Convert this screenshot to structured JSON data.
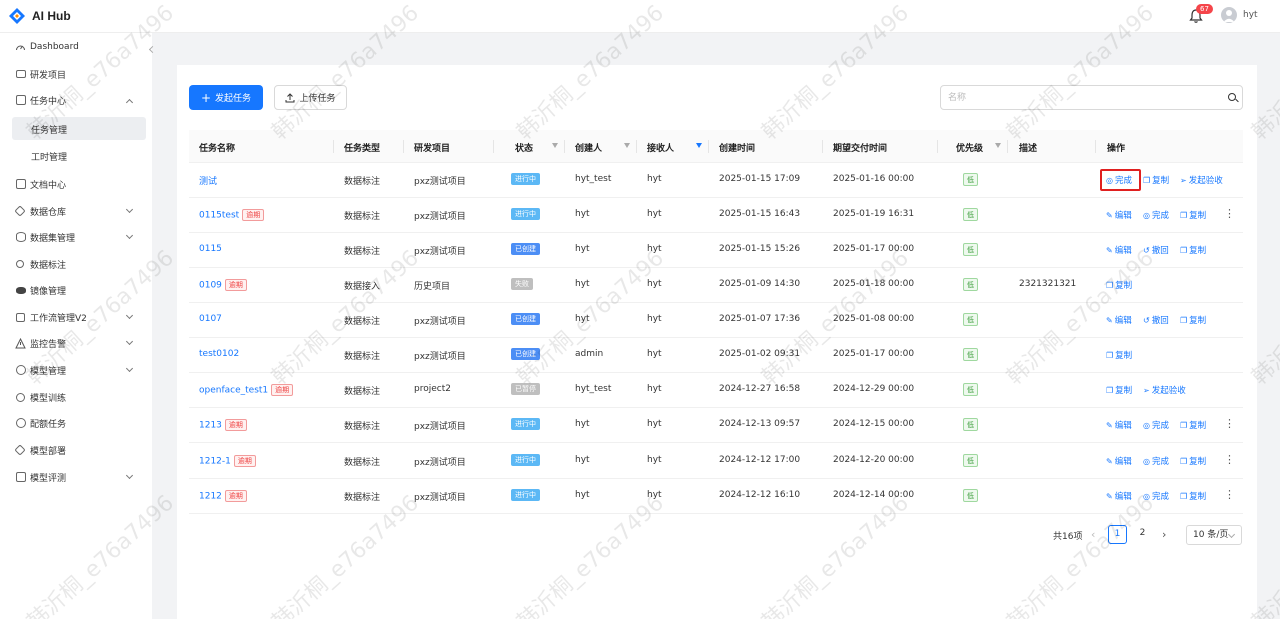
{
  "app": {
    "name": "AI Hub",
    "notification_count": "67",
    "username": "hyt"
  },
  "sidebar": {
    "items": [
      {
        "label": "Dashboard",
        "icon": "dashboard-icon"
      },
      {
        "label": "研发项目",
        "icon": "folder-icon"
      },
      {
        "label": "任务中心",
        "icon": "task-icon",
        "expanded": true
      },
      {
        "label": "任务管理",
        "sub": true,
        "active": true
      },
      {
        "label": "工时管理",
        "sub": true
      },
      {
        "label": "文档中心",
        "icon": "doc-icon"
      },
      {
        "label": "数据仓库",
        "icon": "warehouse-icon"
      },
      {
        "label": "数据集管理",
        "icon": "database-icon"
      },
      {
        "label": "数据标注",
        "icon": "annotation-icon"
      },
      {
        "label": "镜像管理",
        "icon": "image-icon"
      },
      {
        "label": "工作流管理V2",
        "icon": "workflow-icon"
      },
      {
        "label": "监控告警",
        "icon": "alert-icon"
      },
      {
        "label": "模型管理",
        "icon": "model-icon"
      },
      {
        "label": "模型训练",
        "icon": "train-icon"
      },
      {
        "label": "配额任务",
        "icon": "quota-icon"
      },
      {
        "label": "模型部署",
        "icon": "deploy-icon"
      },
      {
        "label": "模型评测",
        "icon": "eval-icon"
      }
    ]
  },
  "toolbar": {
    "create_label": "发起任务",
    "upload_label": "上传任务",
    "search_placeholder": "名称"
  },
  "table": {
    "columns": [
      "任务名称",
      "任务类型",
      "研发项目",
      "状态",
      "创建人",
      "接收人",
      "创建时间",
      "期望交付时间",
      "优先级",
      "描述",
      "操作"
    ],
    "rows": [
      {
        "name": "测试",
        "overdue": "",
        "type": "数据标注",
        "project": "pxz测试项目",
        "status": "进行中",
        "status_color": "blue",
        "creator": "hyt_test",
        "receiver": "hyt",
        "created": "2025-01-15 17:09",
        "due": "2025-01-16 00:00",
        "priority": "低",
        "desc": "",
        "actions": [
          "完成",
          "复制",
          "发起验收"
        ],
        "more": false
      },
      {
        "name": "0115test",
        "overdue": "逾期",
        "type": "数据标注",
        "project": "pxz测试项目",
        "status": "进行中",
        "status_color": "blue",
        "creator": "hyt",
        "receiver": "hyt",
        "created": "2025-01-15 16:43",
        "due": "2025-01-19 16:31",
        "priority": "低",
        "desc": "",
        "actions": [
          "编辑",
          "完成",
          "复制"
        ],
        "more": true
      },
      {
        "name": "0115",
        "overdue": "",
        "type": "数据标注",
        "project": "pxz测试项目",
        "status": "已创建",
        "status_color": "dblue",
        "creator": "hyt",
        "receiver": "hyt",
        "created": "2025-01-15 15:26",
        "due": "2025-01-17 00:00",
        "priority": "低",
        "desc": "",
        "actions": [
          "编辑",
          "撤回",
          "复制"
        ],
        "more": false
      },
      {
        "name": "0109",
        "overdue": "逾期",
        "type": "数据接入",
        "project": "历史项目",
        "status": "失败",
        "status_color": "grey",
        "creator": "hyt",
        "receiver": "hyt",
        "created": "2025-01-09 14:30",
        "due": "2025-01-18 00:00",
        "priority": "低",
        "desc": "2321321321",
        "actions": [
          "复制"
        ],
        "more": false
      },
      {
        "name": "0107",
        "overdue": "",
        "type": "数据标注",
        "project": "pxz测试项目",
        "status": "已创建",
        "status_color": "dblue",
        "creator": "hyt",
        "receiver": "hyt",
        "created": "2025-01-07 17:36",
        "due": "2025-01-08 00:00",
        "priority": "低",
        "desc": "",
        "actions": [
          "编辑",
          "撤回",
          "复制"
        ],
        "more": false
      },
      {
        "name": "test0102",
        "overdue": "",
        "type": "数据标注",
        "project": "pxz测试项目",
        "status": "已创建",
        "status_color": "dblue",
        "creator": "admin",
        "receiver": "hyt",
        "created": "2025-01-02 09:31",
        "due": "2025-01-17 00:00",
        "priority": "低",
        "desc": "",
        "actions": [
          "复制"
        ],
        "more": false
      },
      {
        "name": "openface_test1",
        "overdue": "逾期",
        "type": "数据标注",
        "project": "project2",
        "status": "已暂停",
        "status_color": "grey",
        "creator": "hyt_test",
        "receiver": "hyt",
        "created": "2024-12-27 16:58",
        "due": "2024-12-29 00:00",
        "priority": "低",
        "desc": "",
        "actions": [
          "复制",
          "发起验收"
        ],
        "more": false
      },
      {
        "name": "1213",
        "overdue": "逾期",
        "type": "数据标注",
        "project": "pxz测试项目",
        "status": "进行中",
        "status_color": "blue",
        "creator": "hyt",
        "receiver": "hyt",
        "created": "2024-12-13 09:57",
        "due": "2024-12-15 00:00",
        "priority": "低",
        "desc": "",
        "actions": [
          "编辑",
          "完成",
          "复制"
        ],
        "more": true
      },
      {
        "name": "1212-1",
        "overdue": "逾期",
        "type": "数据标注",
        "project": "pxz测试项目",
        "status": "进行中",
        "status_color": "blue",
        "creator": "hyt",
        "receiver": "hyt",
        "created": "2024-12-12 17:00",
        "due": "2024-12-20 00:00",
        "priority": "低",
        "desc": "",
        "actions": [
          "编辑",
          "完成",
          "复制"
        ],
        "more": true
      },
      {
        "name": "1212",
        "overdue": "逾期",
        "type": "数据标注",
        "project": "pxz测试项目",
        "status": "进行中",
        "status_color": "blue",
        "creator": "hyt",
        "receiver": "hyt",
        "created": "2024-12-12 16:10",
        "due": "2024-12-14 00:00",
        "priority": "低",
        "desc": "",
        "actions": [
          "编辑",
          "完成",
          "复制"
        ],
        "more": true
      }
    ]
  },
  "pagination": {
    "total": "共16项",
    "pages": [
      "1",
      "2"
    ],
    "current": "1",
    "page_size": "10 条/页"
  },
  "watermark": "韩沂桐_e76a7496",
  "colors": {
    "primary": "#1677ff",
    "danger": "#e02020",
    "status_blue": "#5cb8f5",
    "status_created": "#4c8ef5",
    "status_grey": "#bfbfbf"
  }
}
